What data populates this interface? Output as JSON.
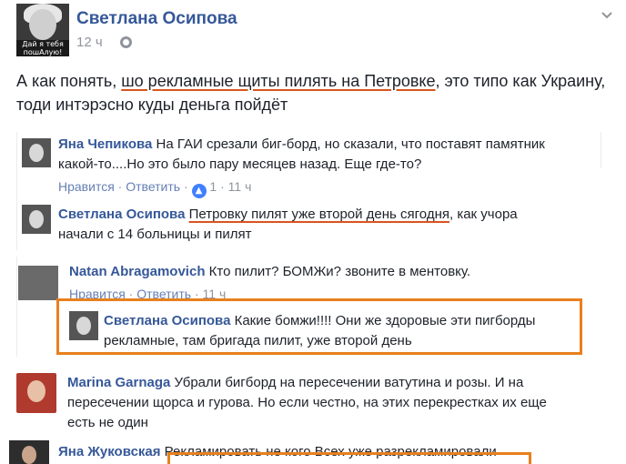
{
  "post": {
    "author": "Светлана Осипова",
    "time": "12 ч",
    "avatar_caption": "Дай я тебя пошАлую!",
    "text_before": "А как понять, ",
    "text_underlined": "шо рекламные щиты пилять на Петровке",
    "text_after": ", это типо как Украину, тоди интэрэсно куды деньга пойдёт"
  },
  "comments": [
    {
      "author": "Яна Чепикова",
      "text": " На ГАИ срезали биг-борд, но сказали, что поставят памятник какой-то....Но это было пару месяцев назад. Еще где-то?",
      "like": "Нравится",
      "reply": "Ответить",
      "sep": " · ",
      "reactions": "1",
      "time": "11 ч"
    },
    {
      "author": "Светлана Осипова",
      "text_underlined": "Петровку пилят уже второй день сягодня",
      "text_after": ", как учора начали с 14 больницы и пилят"
    },
    {
      "author": "Natan Abragamovich",
      "text": " Кто пилит? БОМЖи? звоните в ментовку.",
      "like": "Нравится",
      "reply": "Ответить",
      "time": "11 ч"
    },
    {
      "author": "Светлана Осипова",
      "text": " Какие бомжи!!!! Они же здоровые эти пигборды рекламные, там бригада пилит, уже второй день"
    },
    {
      "author": "Marina Garnaga",
      "text": " Убрали бигборд на пересечении ватутина и розы. И на пересечении щорса и гурова. Но если честно, на этих перекрестках их еще есть не один"
    },
    {
      "author": "Яна Жуковская",
      "text": " Рекламировать не кого Всех уже разрекламировали"
    }
  ],
  "icons": {
    "globe": "globe-icon",
    "chevron": "chevron-down-icon",
    "like": "thumbs-up-icon"
  },
  "colors": {
    "link": "#365899",
    "meta": "#90949c",
    "highlight": "#e8801e",
    "underline": "#d9541e"
  }
}
